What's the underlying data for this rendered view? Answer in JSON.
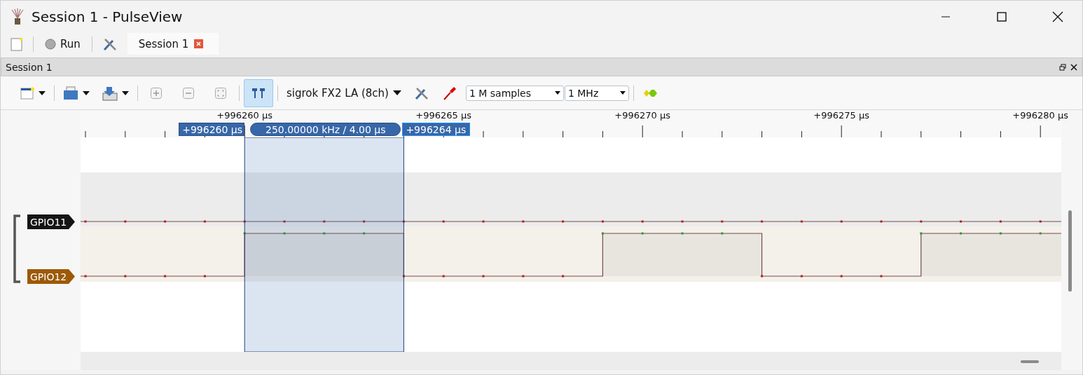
{
  "window": {
    "title": "Session 1 - PulseView"
  },
  "main_toolbar": {
    "run_label": "Run",
    "tabs": [
      {
        "label": "Session 1",
        "selected": true
      }
    ]
  },
  "dock": {
    "title": "Session 1"
  },
  "session_toolbar": {
    "cursor_button": {
      "selected": true
    },
    "device": "sigrok FX2 LA (8ch)",
    "sample_count": "1 M samples",
    "sample_rate": "1 MHz"
  },
  "ruler": {
    "labels": [
      "+996260 µs",
      "+996265 µs",
      "+996270 µs",
      "+996275 µs",
      "+996280 µs"
    ]
  },
  "cursors": {
    "start_label": "+996260 µs",
    "end_label": "+996264 µs",
    "width_label": "250.00000 kHz / 4.00 µs"
  },
  "signals": [
    {
      "name": "GPIO11",
      "color": "#151515",
      "samples": [
        {
          "high": false
        },
        {
          "high": false
        },
        {
          "high": false
        },
        {
          "high": false
        },
        {
          "high": false
        },
        {
          "high": false
        },
        {
          "high": false
        },
        {
          "high": false
        },
        {
          "high": false
        },
        {
          "high": false
        },
        {
          "high": false
        },
        {
          "high": false
        },
        {
          "high": false
        },
        {
          "high": false
        },
        {
          "high": false
        },
        {
          "high": false
        },
        {
          "high": false
        },
        {
          "high": false
        },
        {
          "high": false
        },
        {
          "high": false
        },
        {
          "high": false
        },
        {
          "high": false
        },
        {
          "high": false
        },
        {
          "high": false
        },
        {
          "high": false
        }
      ]
    },
    {
      "name": "GPIO12",
      "color": "#9c5a07",
      "samples": [
        {
          "high": false
        },
        {
          "high": false
        },
        {
          "high": false
        },
        {
          "high": false
        },
        {
          "high": true
        },
        {
          "high": true
        },
        {
          "high": true
        },
        {
          "high": true
        },
        {
          "high": false
        },
        {
          "high": false
        },
        {
          "high": false
        },
        {
          "high": false
        },
        {
          "high": false
        },
        {
          "high": true
        },
        {
          "high": true
        },
        {
          "high": true
        },
        {
          "high": true
        },
        {
          "high": false
        },
        {
          "high": false
        },
        {
          "high": false
        },
        {
          "high": false
        },
        {
          "high": true
        },
        {
          "high": true
        },
        {
          "high": true
        },
        {
          "high": true
        }
      ]
    }
  ]
}
